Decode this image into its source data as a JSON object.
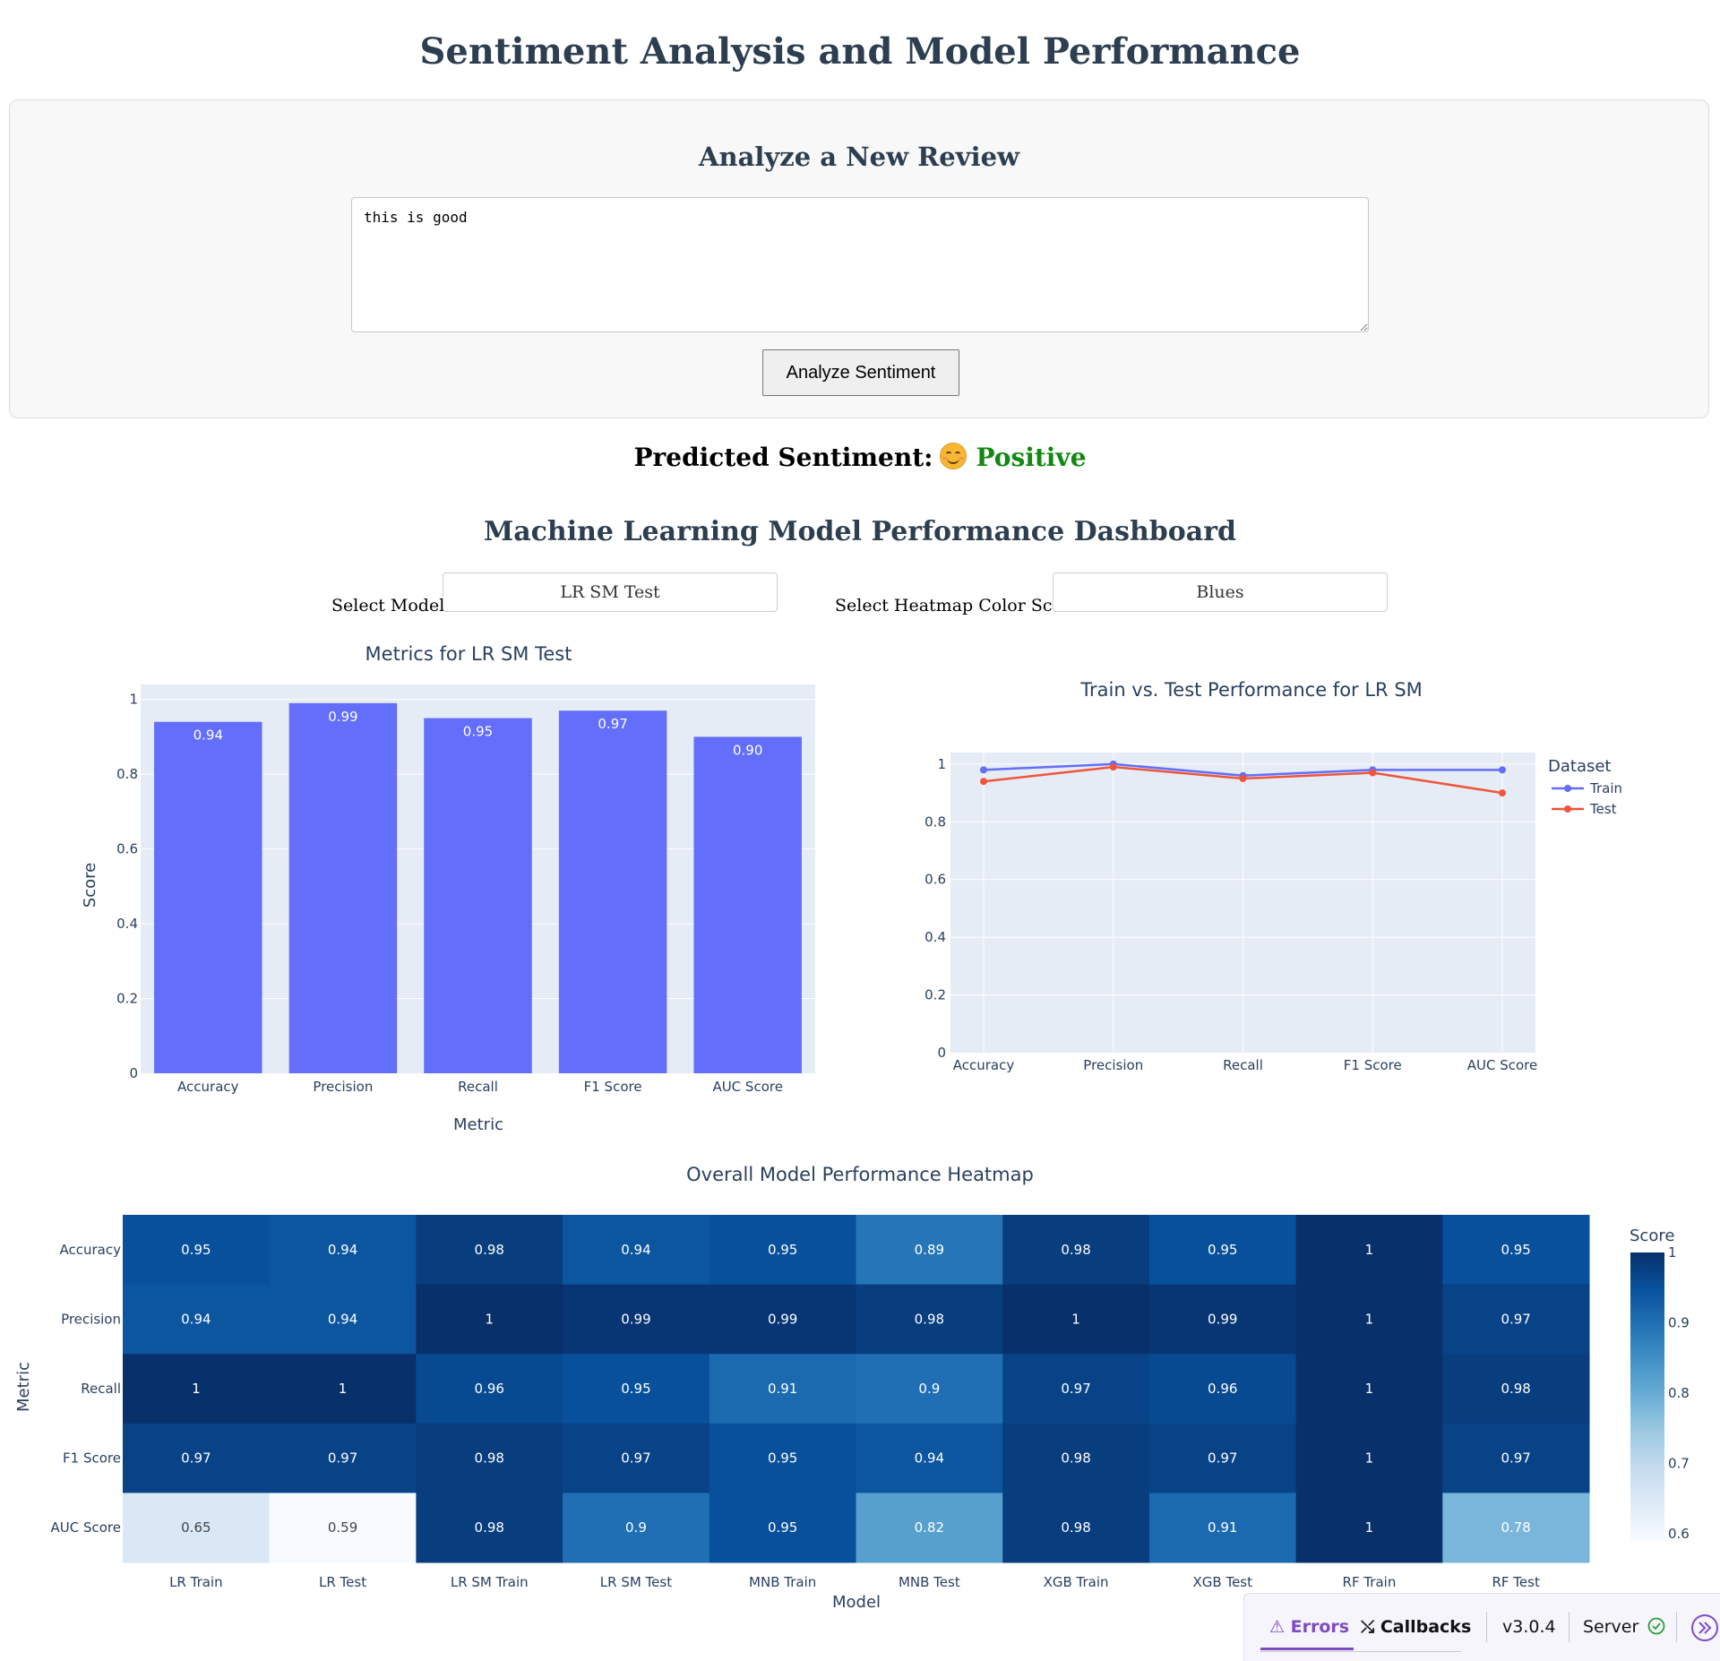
{
  "page": {
    "title": "Sentiment Analysis and Model Performance"
  },
  "review": {
    "heading": "Analyze a New Review",
    "text": "this is good",
    "button_label": "Analyze Sentiment"
  },
  "prediction": {
    "label": "Predicted Sentiment:",
    "value": "Positive",
    "emoji": "smiling-face-icon",
    "color": "#118811"
  },
  "dashboard": {
    "title": "Machine Learning Model Performance Dashboard",
    "model_label": "Select Model:",
    "model_value": "LR SM Test",
    "scale_label": "Select Heatmap Color Scale:",
    "scale_value": "Blues"
  },
  "bar_chart": {
    "title": "Metrics for LR SM Test",
    "xlabel": "Metric",
    "ylabel": "Score",
    "color": "#636efa"
  },
  "line_chart": {
    "title": "Train vs. Test Performance for LR SM",
    "legend_title": "Dataset",
    "colors": {
      "Train": "#636efa",
      "Test": "#ef553b"
    }
  },
  "heatmap": {
    "title": "Overall Model Performance Heatmap",
    "xlabel": "Model",
    "ylabel": "Metric",
    "colorbar_title": "Score"
  },
  "chart_data": [
    {
      "type": "bar",
      "title": "Metrics for LR SM Test",
      "xlabel": "Metric",
      "ylabel": "Score",
      "categories": [
        "Accuracy",
        "Precision",
        "Recall",
        "F1 Score",
        "AUC Score"
      ],
      "values": [
        0.94,
        0.99,
        0.95,
        0.97,
        0.9
      ],
      "data_labels": [
        "0.94",
        "0.99",
        "0.95",
        "0.97",
        "0.90"
      ],
      "ylim": [
        0,
        1.04
      ],
      "yticks": [
        "0",
        "0.2",
        "0.4",
        "0.6",
        "0.8",
        "1"
      ],
      "grid": true
    },
    {
      "type": "line",
      "title": "Train vs. Test Performance for LR SM",
      "categories": [
        "Accuracy",
        "Precision",
        "Recall",
        "F1 Score",
        "AUC Score"
      ],
      "series": [
        {
          "name": "Train",
          "values": [
            0.98,
            1.0,
            0.96,
            0.98,
            0.98
          ]
        },
        {
          "name": "Test",
          "values": [
            0.94,
            0.99,
            0.95,
            0.97,
            0.9
          ]
        }
      ],
      "ylim": [
        0,
        1.04
      ],
      "yticks": [
        "0",
        "0.2",
        "0.4",
        "0.6",
        "0.8",
        "1"
      ],
      "legend": "top-right",
      "grid": true
    },
    {
      "type": "heatmap",
      "title": "Overall Model Performance Heatmap",
      "xlabel": "Model",
      "ylabel": "Metric",
      "x": [
        "LR Train",
        "LR Test",
        "LR SM Train",
        "LR SM Test",
        "MNB Train",
        "MNB Test",
        "XGB Train",
        "XGB Test",
        "RF Train",
        "RF Test"
      ],
      "y": [
        "Accuracy",
        "Precision",
        "Recall",
        "F1 Score",
        "AUC Score"
      ],
      "z": [
        [
          0.95,
          0.94,
          0.98,
          0.94,
          0.95,
          0.89,
          0.98,
          0.95,
          1,
          0.95
        ],
        [
          0.94,
          0.94,
          1,
          0.99,
          0.99,
          0.98,
          1,
          0.99,
          1,
          0.97
        ],
        [
          1,
          1,
          0.96,
          0.95,
          0.91,
          0.9,
          0.97,
          0.96,
          1,
          0.98
        ],
        [
          0.97,
          0.97,
          0.98,
          0.97,
          0.95,
          0.94,
          0.98,
          0.97,
          1,
          0.97
        ],
        [
          0.65,
          0.59,
          0.98,
          0.9,
          0.95,
          0.82,
          0.98,
          0.91,
          1,
          0.78
        ]
      ],
      "colorscale": "Blues",
      "colorbar_title": "Score",
      "colorbar_ticks": [
        "1",
        "0.9",
        "0.8",
        "0.7",
        "0.6"
      ]
    }
  ],
  "devtools": {
    "errors_label": "Errors",
    "callbacks_label": "Callbacks",
    "version": "v3.0.4",
    "server_label": "Server",
    "accent": "#7f4bc4"
  }
}
